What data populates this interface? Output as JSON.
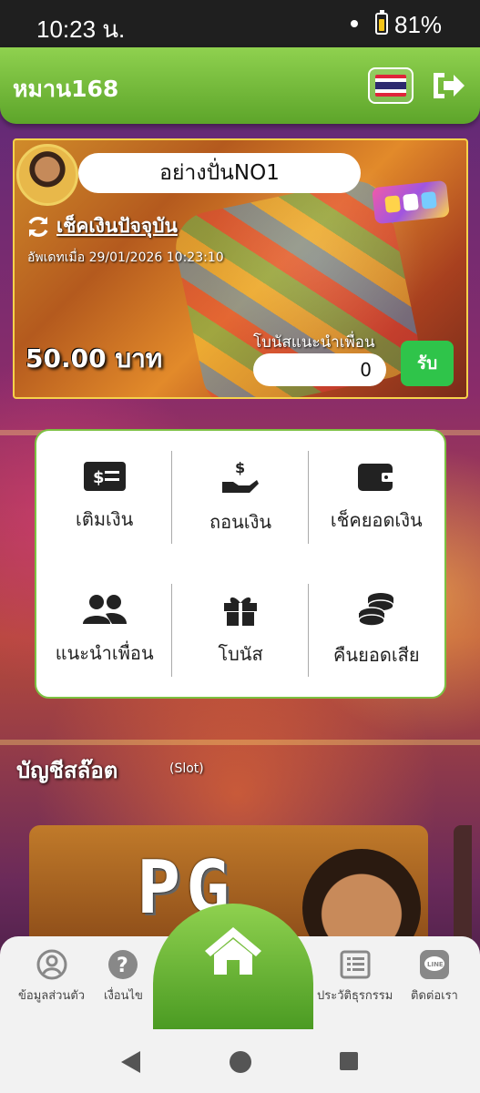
{
  "status_bar": {
    "time": "10:23 น.",
    "battery": "81%"
  },
  "header": {
    "brand": "หมาน168",
    "language_flag": "thai-flag-icon",
    "logout_icon": "logout-icon"
  },
  "balance_card": {
    "username": "อย่างปั่นNO1",
    "refresh_label": "เช็คเงินปัจจุบัน",
    "updated_text": "อัพเดทเมื่อ 29/01/2026 10:23:10",
    "balance": "50.00 บาท",
    "referral_bonus_label": "โบนัสแนะนำเพื่อน",
    "referral_bonus_value": "0",
    "claim_label": "รับ"
  },
  "menu": [
    {
      "label": "เติมเงิน",
      "icon": "deposit-icon"
    },
    {
      "label": "ถอนเงิน",
      "icon": "withdraw-icon"
    },
    {
      "label": "เช็คยอดเงิน",
      "icon": "wallet-icon"
    },
    {
      "label": "แนะนำเพื่อน",
      "icon": "friends-icon"
    },
    {
      "label": "โบนัส",
      "icon": "gift-icon"
    },
    {
      "label": "คืนยอดเสีย",
      "icon": "coins-icon"
    }
  ],
  "section": {
    "title": "บัญชีสล๊อต",
    "subtitle": "(Slot)",
    "provider": "PG"
  },
  "bottom_nav": [
    {
      "label": "ข้อมูลส่วนตัว",
      "icon": "profile-icon"
    },
    {
      "label": "เงื่อนไข",
      "icon": "help-icon"
    },
    {
      "label": "",
      "icon": "home-icon"
    },
    {
      "label": "ประวัติธุรกรรม",
      "icon": "history-icon"
    },
    {
      "label": "ติดต่อเรา",
      "icon": "line-icon"
    }
  ],
  "colors": {
    "brand_green": "#6ab832",
    "claim_green": "#2fc44a",
    "card_border": "#f7d34a"
  }
}
